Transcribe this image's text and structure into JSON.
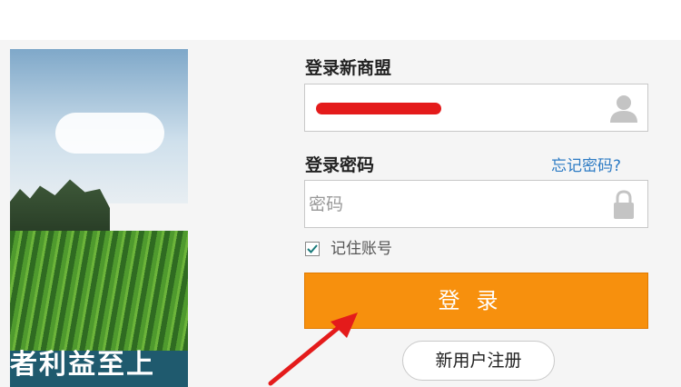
{
  "banner": {
    "slogan": "者利益至上"
  },
  "login": {
    "account_label": "登录新商盟",
    "account_value": "",
    "password_label": "登录密码",
    "forgot_link": "忘记密码?",
    "password_placeholder": "密码",
    "remember_label": "记住账号",
    "remember_checked": true,
    "submit_label": "登录",
    "register_label": "新用户注册"
  },
  "icons": {
    "account": "user-icon",
    "password": "lock-icon",
    "remember": "check-icon",
    "annotation": "red-arrow-icon"
  },
  "colors": {
    "submit_bg": "#f7900d",
    "link": "#2d7bc4",
    "annotation_arrow": "#e41b1b",
    "redaction": "#e41b1b"
  }
}
